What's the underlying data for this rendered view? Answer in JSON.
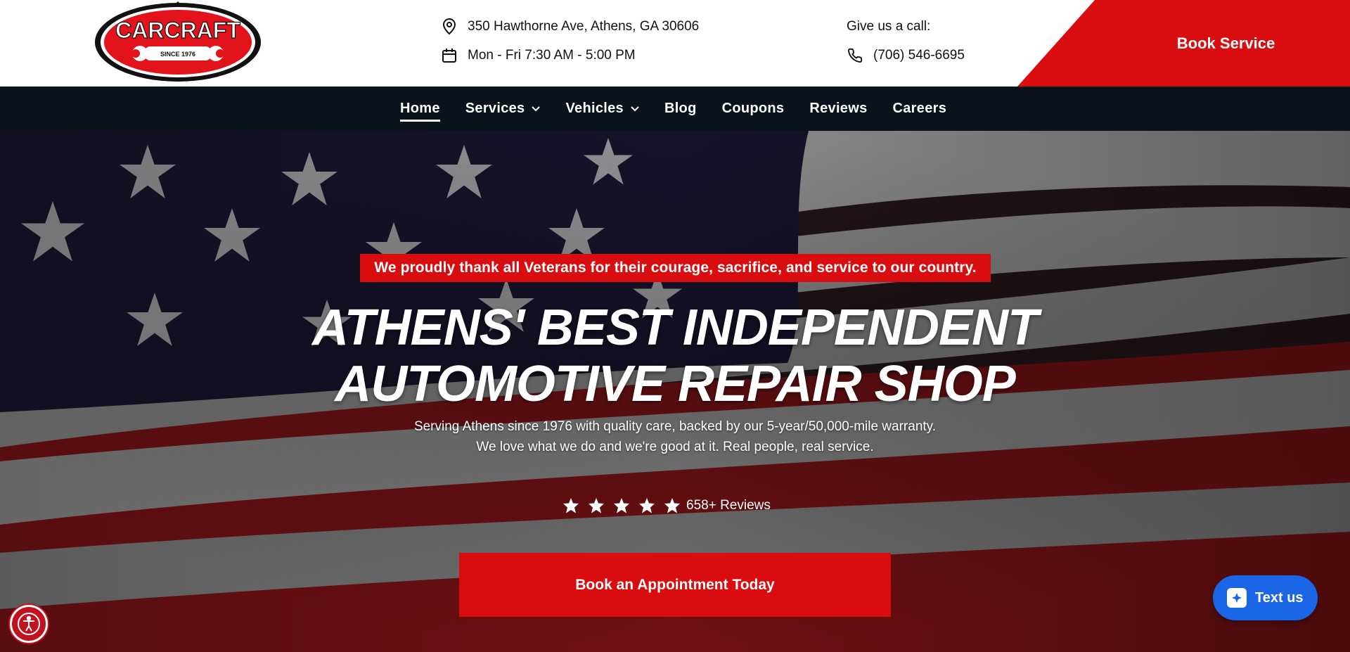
{
  "header": {
    "logo_text": "CARCRAFT",
    "logo_since": "SINCE 1976",
    "address": "350 Hawthorne Ave, Athens, GA 30606",
    "hours": "Mon - Fri 7:30 AM - 5:00 PM",
    "call_label": "Give us a call:",
    "phone": "(706) 546-6695",
    "book_service_label": "Book Service"
  },
  "nav": {
    "items": [
      {
        "label": "Home",
        "active": true,
        "dropdown": false
      },
      {
        "label": "Services",
        "active": false,
        "dropdown": true
      },
      {
        "label": "Vehicles",
        "active": false,
        "dropdown": true
      },
      {
        "label": "Blog",
        "active": false,
        "dropdown": false
      },
      {
        "label": "Coupons",
        "active": false,
        "dropdown": false
      },
      {
        "label": "Reviews",
        "active": false,
        "dropdown": false
      },
      {
        "label": "Careers",
        "active": false,
        "dropdown": false
      }
    ]
  },
  "hero": {
    "banner": "We proudly thank all Veterans for their courage, sacrifice, and service to our country.",
    "headline_line1": "ATHENS' BEST INDEPENDENT",
    "headline_line2": "AUTOMOTIVE REPAIR SHOP",
    "sub_line1": "Serving Athens since 1976 with quality care, backed by our 5-year/50,000-mile warranty.",
    "sub_line2": "We love what we do and we're good at it. Real people, real service.",
    "rating_stars": 5,
    "reviews_label": "658+ Reviews",
    "cta_label": "Book an Appointment Today"
  },
  "widgets": {
    "text_us_label": "Text us",
    "accessibility_icon": "accessibility-icon"
  },
  "colors": {
    "brand_red": "#d90d10",
    "nav_bg": "#0a131b",
    "chat_blue": "#1a66e6"
  }
}
